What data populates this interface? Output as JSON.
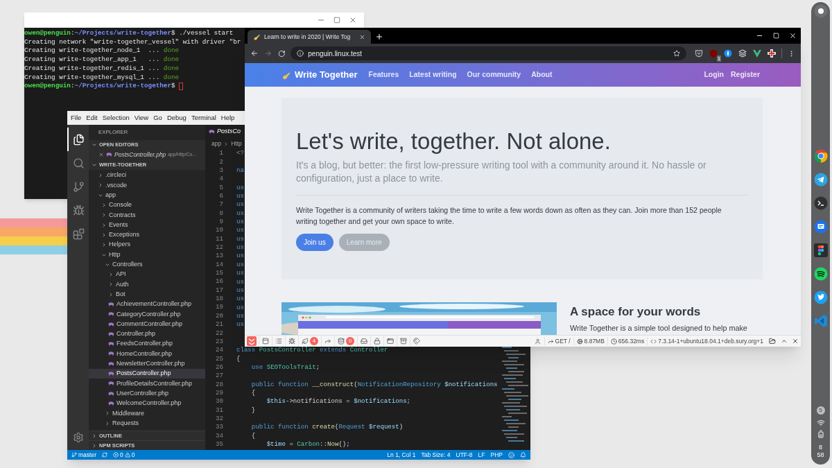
{
  "desktop": {
    "shelf": {
      "apps": [
        {
          "kind": "chrome"
        },
        {
          "kind": "telegram"
        },
        {
          "kind": "terminal"
        },
        {
          "kind": "messages"
        },
        {
          "kind": "figma"
        },
        {
          "kind": "spotify"
        },
        {
          "kind": "twitter"
        },
        {
          "kind": "vscode"
        }
      ],
      "notification_count": "5",
      "clock": {
        "hour": "8",
        "minute": "58"
      }
    }
  },
  "terminal": {
    "lines": [
      [
        {
          "text": "owen@penguin",
          "kind": "user"
        },
        {
          "text": ":",
          "kind": "plain"
        },
        {
          "text": "~/Projects/write-together",
          "kind": "path"
        },
        {
          "text": "$ ./vessel start",
          "kind": "plain"
        }
      ],
      [
        {
          "text": "Creating network \"write-together_vessel\" with driver \"br",
          "kind": "plain"
        }
      ],
      [
        {
          "text": "Creating write-together_node_1  ... ",
          "kind": "plain"
        },
        {
          "text": "done",
          "kind": "ok"
        }
      ],
      [
        {
          "text": "Creating write-together_app_1   ... ",
          "kind": "plain"
        },
        {
          "text": "done",
          "kind": "ok"
        }
      ],
      [
        {
          "text": "Creating write-together_redis_1 ... ",
          "kind": "plain"
        },
        {
          "text": "done",
          "kind": "ok"
        }
      ],
      [
        {
          "text": "Creating write-together_mysql_1 ... ",
          "kind": "plain"
        },
        {
          "text": "done",
          "kind": "ok"
        }
      ],
      [
        {
          "text": "owen@penguin",
          "kind": "user"
        },
        {
          "text": ":",
          "kind": "plain"
        },
        {
          "text": "~/Projects/write-together",
          "kind": "path"
        },
        {
          "text": "$ ",
          "kind": "plain"
        }
      ]
    ]
  },
  "vscode": {
    "menu": [
      "File",
      "Edit",
      "Selection",
      "View",
      "Go",
      "Debug",
      "Terminal",
      "Help"
    ],
    "activity": [
      {
        "kind": "files",
        "selected": true
      },
      {
        "kind": "search",
        "selected": false
      },
      {
        "kind": "source-control",
        "selected": false
      },
      {
        "kind": "debug",
        "selected": false
      },
      {
        "kind": "extensions",
        "selected": false
      }
    ],
    "explorer": {
      "title": "EXPLORER",
      "open_editors": {
        "title": "OPEN EDITORS",
        "expanded": true,
        "files": [
          {
            "name": "PostsController.php",
            "path": "app/Http/Co…"
          }
        ]
      },
      "project": {
        "title": "WRITE-TOGETHER",
        "expanded": true,
        "tree": [
          {
            "name": ".circleci",
            "kind": "folder",
            "expanded": false,
            "selected": false
          },
          {
            "name": ".vscode",
            "kind": "folder",
            "expanded": false,
            "selected": false
          },
          {
            "name": "app",
            "kind": "folder",
            "expanded": true,
            "selected": false,
            "children": [
              {
                "name": "Console",
                "kind": "folder",
                "expanded": false,
                "selected": false
              },
              {
                "name": "Contracts",
                "kind": "folder",
                "expanded": false,
                "selected": false
              },
              {
                "name": "Events",
                "kind": "folder",
                "expanded": false,
                "selected": false
              },
              {
                "name": "Exceptions",
                "kind": "folder",
                "expanded": false,
                "selected": false
              },
              {
                "name": "Helpers",
                "kind": "folder",
                "expanded": false,
                "selected": false
              },
              {
                "name": "Http",
                "kind": "folder",
                "expanded": true,
                "selected": false,
                "children": [
                  {
                    "name": "Controllers",
                    "kind": "folder",
                    "expanded": true,
                    "selected": false,
                    "children": [
                      {
                        "name": "API",
                        "kind": "folder",
                        "expanded": false,
                        "selected": false
                      },
                      {
                        "name": "Auth",
                        "kind": "folder",
                        "expanded": false,
                        "selected": false
                      },
                      {
                        "name": "Bot",
                        "kind": "folder",
                        "expanded": false,
                        "selected": false
                      },
                      {
                        "name": "AchievementController.php",
                        "kind": "file",
                        "selected": false
                      },
                      {
                        "name": "CategoryController.php",
                        "kind": "file",
                        "selected": false
                      },
                      {
                        "name": "CommentController.php",
                        "kind": "file",
                        "selected": false
                      },
                      {
                        "name": "Controller.php",
                        "kind": "file",
                        "selected": false
                      },
                      {
                        "name": "FeedsController.php",
                        "kind": "file",
                        "selected": false
                      },
                      {
                        "name": "HomeController.php",
                        "kind": "file",
                        "selected": false
                      },
                      {
                        "name": "NewsletterController.php",
                        "kind": "file",
                        "selected": false
                      },
                      {
                        "name": "PostsController.php",
                        "kind": "file",
                        "selected": true
                      },
                      {
                        "name": "ProfileDetailsController.php",
                        "kind": "file",
                        "selected": false
                      },
                      {
                        "name": "UserController.php",
                        "kind": "file",
                        "selected": false
                      },
                      {
                        "name": "WelcomeController.php",
                        "kind": "file",
                        "selected": false
                      }
                    ]
                  },
                  {
                    "name": "Middleware",
                    "kind": "folder",
                    "expanded": false,
                    "selected": false
                  },
                  {
                    "name": "Requests",
                    "kind": "folder",
                    "expanded": false,
                    "selected": false
                  }
                ]
              }
            ]
          }
        ]
      },
      "panels": [
        {
          "title": "OUTLINE",
          "expanded": false
        },
        {
          "title": "NPM SCRIPTS",
          "expanded": false
        }
      ]
    },
    "editor": {
      "tab": "PostsCo",
      "breadcrumb": [
        "app",
        "Http"
      ],
      "lines": [
        {
          "n": "1",
          "tokens": [
            {
              "text": "<?",
              "kind": "tag"
            }
          ]
        },
        {
          "n": "2"
        },
        {
          "n": "3",
          "tokens": [
            {
              "text": "na",
              "kind": "kw"
            }
          ]
        },
        {
          "n": "4"
        },
        {
          "n": "5",
          "tokens": [
            {
              "text": "us",
              "kind": "kw"
            }
          ]
        },
        {
          "n": "6",
          "tokens": [
            {
              "text": "us",
              "kind": "kw"
            }
          ]
        },
        {
          "n": "7",
          "tokens": [
            {
              "text": "us",
              "kind": "kw"
            }
          ]
        },
        {
          "n": "8",
          "tokens": [
            {
              "text": "us",
              "kind": "kw"
            }
          ]
        },
        {
          "n": "9",
          "tokens": [
            {
              "text": "us",
              "kind": "kw"
            }
          ]
        },
        {
          "n": "10",
          "tokens": [
            {
              "text": "us",
              "kind": "kw"
            }
          ]
        },
        {
          "n": "11",
          "tokens": [
            {
              "text": "us",
              "kind": "kw"
            }
          ]
        },
        {
          "n": "12",
          "tokens": [
            {
              "text": "us",
              "kind": "kw"
            }
          ]
        },
        {
          "n": "13",
          "tokens": [
            {
              "text": "us",
              "kind": "kw"
            }
          ]
        },
        {
          "n": "14",
          "tokens": [
            {
              "text": "us",
              "kind": "kw"
            }
          ]
        },
        {
          "n": "15",
          "tokens": [
            {
              "text": "us",
              "kind": "kw"
            }
          ]
        },
        {
          "n": "16",
          "tokens": [
            {
              "text": "us",
              "kind": "kw"
            }
          ]
        },
        {
          "n": "17",
          "tokens": [
            {
              "text": "us",
              "kind": "kw"
            }
          ]
        },
        {
          "n": "18",
          "tokens": [
            {
              "text": "us",
              "kind": "kw"
            }
          ]
        },
        {
          "n": "19",
          "tokens": [
            {
              "text": "us",
              "kind": "kw"
            }
          ]
        },
        {
          "n": "20",
          "tokens": [
            {
              "text": "us",
              "kind": "kw"
            }
          ]
        },
        {
          "n": "21",
          "tokens": [
            {
              "text": "us",
              "kind": "kw"
            }
          ]
        },
        {
          "n": "22"
        },
        {
          "n": "23"
        },
        {
          "n": "24",
          "tokens": [
            {
              "text": "class ",
              "kind": "kw"
            },
            {
              "text": "PostsController ",
              "kind": "cls"
            },
            {
              "text": "extends ",
              "kind": "kw"
            },
            {
              "text": "Controller",
              "kind": "cls"
            }
          ]
        },
        {
          "n": "25",
          "tokens": [
            {
              "text": "{",
              "kind": "plain"
            }
          ]
        },
        {
          "n": "26",
          "tokens": [
            {
              "text": "    use ",
              "kind": "kw"
            },
            {
              "text": "SEOToolsTrait",
              "kind": "cls"
            },
            {
              "text": ";",
              "kind": "plain"
            }
          ]
        },
        {
          "n": "27"
        },
        {
          "n": "28",
          "tokens": [
            {
              "text": "    public function ",
              "kind": "kw"
            },
            {
              "text": "__construct",
              "kind": "func"
            },
            {
              "text": "(",
              "kind": "plain"
            },
            {
              "text": "NotificationRepository ",
              "kind": "type"
            },
            {
              "text": "$notifications",
              "kind": "var"
            }
          ]
        },
        {
          "n": "29",
          "tokens": [
            {
              "text": "    {",
              "kind": "plain"
            }
          ]
        },
        {
          "n": "30",
          "tokens": [
            {
              "text": "        $this",
              "kind": "var"
            },
            {
              "text": "->notifications = ",
              "kind": "plain"
            },
            {
              "text": "$notifications",
              "kind": "var"
            },
            {
              "text": ";",
              "kind": "plain"
            }
          ]
        },
        {
          "n": "31",
          "tokens": [
            {
              "text": "    }",
              "kind": "plain"
            }
          ]
        },
        {
          "n": "32"
        },
        {
          "n": "33",
          "tokens": [
            {
              "text": "    public function ",
              "kind": "kw"
            },
            {
              "text": "create",
              "kind": "func"
            },
            {
              "text": "(",
              "kind": "plain"
            },
            {
              "text": "Request ",
              "kind": "type"
            },
            {
              "text": "$request",
              "kind": "var"
            },
            {
              "text": ")",
              "kind": "plain"
            }
          ]
        },
        {
          "n": "34",
          "tokens": [
            {
              "text": "    {",
              "kind": "plain"
            }
          ]
        },
        {
          "n": "35",
          "tokens": [
            {
              "text": "        $time",
              "kind": "var"
            },
            {
              "text": " = ",
              "kind": "plain"
            },
            {
              "text": "Carbon",
              "kind": "cls"
            },
            {
              "text": "::",
              "kind": "plain"
            },
            {
              "text": "Now",
              "kind": "func"
            },
            {
              "text": "();",
              "kind": "plain"
            }
          ]
        }
      ]
    },
    "status_bar": {
      "branch": "master",
      "errors": "0",
      "warnings": "0",
      "items": [
        "Ln 1, Col 1",
        "Tab Size: 4",
        "UTF-8",
        "LF",
        "PHP"
      ]
    }
  },
  "chrome": {
    "tab": {
      "title": "Learn to write in 2020 | Write Tog"
    },
    "url": "penguin.linux.test",
    "forward_disabled": true,
    "extensions": [
      {
        "kind": "pocket"
      },
      {
        "kind": "ublock",
        "badge": "1"
      },
      {
        "kind": "password"
      },
      {
        "kind": "buffer"
      },
      {
        "kind": "vue"
      },
      {
        "kind": "medic"
      }
    ],
    "page": {
      "brand": "Write Together",
      "nav": [
        "Features",
        "Latest writing",
        "Our community",
        "About"
      ],
      "auth": [
        "Login",
        "Register"
      ],
      "hero": {
        "title": "Let's write, together. Not alone.",
        "lead": "It's a blog, but better: the first low-pressure writing tool with a community around it. No hassle or configuration, just a place to write.",
        "text": "Write Together is a community of writers taking the time to write a few words down as often as they can. Join more than 152 people writing together and get your own space to write.",
        "buttons": [
          {
            "label": "Join us",
            "kind": "primary"
          },
          {
            "label": "Learn more",
            "kind": "secondary"
          }
        ]
      },
      "feature": {
        "title": "A space for your words",
        "text": "Write Together is a simple tool designed to help make"
      }
    },
    "debugbar": {
      "tabs": [
        {
          "kind": "messages"
        },
        {
          "kind": "timeline"
        },
        {
          "kind": "exceptions"
        },
        {
          "kind": "views",
          "badge": "4"
        },
        {
          "kind": "route"
        },
        {
          "kind": "queries",
          "badge": "0"
        },
        {
          "kind": "mails"
        },
        {
          "kind": "gate"
        },
        {
          "kind": "session"
        },
        {
          "kind": "request"
        },
        {
          "kind": "models"
        }
      ],
      "route": "GET /",
      "memory": "8.87MB",
      "time": "656.32ms",
      "php": "7.3.14-1+ubuntu18.04.1+deb.sury.org+1"
    }
  }
}
